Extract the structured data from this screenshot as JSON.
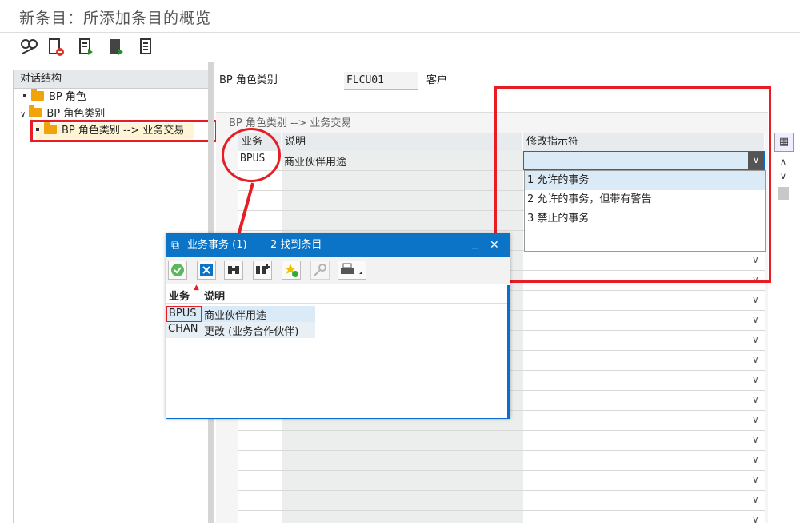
{
  "window": {
    "title": "新条目：所添加条目的概览"
  },
  "toolbar": {
    "icons": [
      "display-icon",
      "delete-icon",
      "select-all-icon",
      "select-block-icon",
      "deselect-icon"
    ]
  },
  "tree": {
    "header": "对话结构",
    "items": [
      {
        "label": "BP 角色"
      },
      {
        "label": "BP 角色类别"
      },
      {
        "label": "BP 角色类别 --> 业务交易"
      }
    ]
  },
  "header_fields": {
    "role_category_label": "BP 角色类别",
    "role_category_value": "FLCU01",
    "role_category_desc": "客户"
  },
  "grid": {
    "title": "BP 角色类别 --> 业务交易",
    "columns": [
      "业务",
      "说明",
      "修改指示符"
    ],
    "row": {
      "code": "BPUS",
      "desc": "商业伙伴用途",
      "indicator": ""
    }
  },
  "dropdown": {
    "options": [
      "1 允许的事务",
      "2 允许的事务，但带有警告",
      "3 禁止的事务"
    ]
  },
  "dialog": {
    "title": "业务事务 (1)",
    "found": "2 找到条目",
    "columns": [
      "业务",
      "说明"
    ],
    "rows": [
      {
        "code": "BPUS",
        "desc": "商业伙伴用途"
      },
      {
        "code": "CHAN",
        "desc": "更改 (业务合作伙伴)"
      }
    ],
    "minimize": "_",
    "close": "✕"
  },
  "colors": {
    "accent": "#0b74c7",
    "highlight": "#e81c24",
    "folder": "#f0a30a"
  }
}
